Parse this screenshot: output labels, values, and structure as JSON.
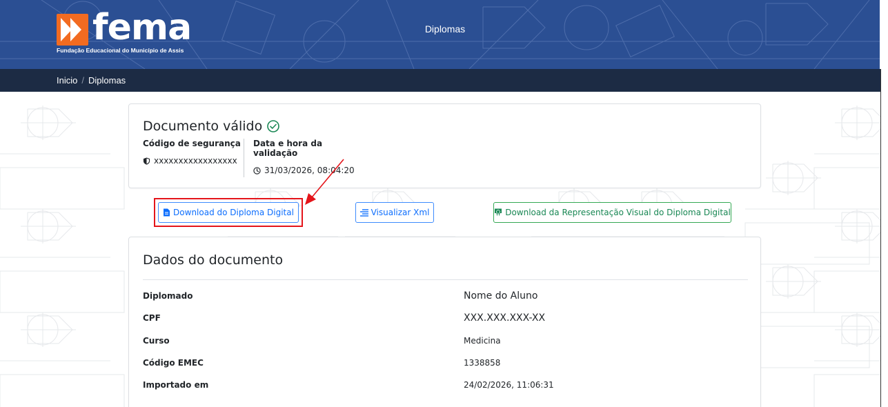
{
  "header": {
    "logo_word": "fema",
    "logo_subtitle": "Fundação Educacional do Município de Assis",
    "title": "Diplomas"
  },
  "breadcrumb": {
    "items": [
      "Inicio",
      "Diplomas"
    ],
    "separator": "/"
  },
  "validation": {
    "title": "Documento válido",
    "security_code_label": "Código de segurança",
    "security_code_value": "xxxxxxxxxxxxxxxxx",
    "datetime_label": "Data e hora da validação",
    "datetime_value": "31/03/2026, 08:04:20"
  },
  "actions": {
    "download_diploma": "Download do Diploma Digital",
    "view_xml": "Visualizar Xml",
    "download_visual": "Download da Representação Visual do Diploma Digital"
  },
  "document_data": {
    "title": "Dados do documento",
    "rows": [
      {
        "label": "Diplomado",
        "value": "Nome do Aluno"
      },
      {
        "label": "CPF",
        "value": "XXX.XXX.XXX-XX"
      },
      {
        "label": "Curso",
        "value": "Medicina"
      },
      {
        "label": "Código EMEC",
        "value": "1338858"
      },
      {
        "label": "Importado em",
        "value": "24/02/2026, 11:06:31"
      }
    ]
  },
  "colors": {
    "header_blue": "#2b4f93",
    "breadcrumb_navy": "#1c2b44",
    "logo_orange": "#f26b21",
    "success_green": "#198754",
    "primary_blue": "#0d6efd",
    "annotation_red": "#e4141a"
  },
  "icons": {
    "valid": "check-circle-icon",
    "security": "shield-icon",
    "datetime": "clock-icon",
    "download": "file-icon",
    "xml": "list-icon",
    "visual": "graduation-icon"
  }
}
